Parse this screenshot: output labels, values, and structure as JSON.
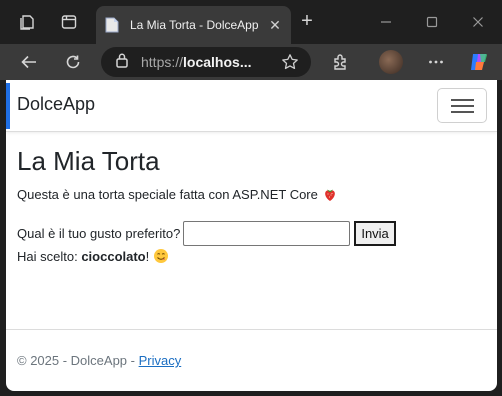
{
  "browser": {
    "tab": {
      "title": "La Mia Torta - DolceApp",
      "close_glyph": "✕"
    },
    "new_tab_glyph": "+",
    "address": {
      "scheme": "https://",
      "host": "localhos..."
    },
    "icons": [
      "workspaces-icon",
      "tab-actions-icon",
      "minimize-icon",
      "maximize-icon",
      "close-window-icon",
      "back-icon",
      "refresh-icon",
      "lock-icon",
      "favorite-star-icon",
      "extensions-icon",
      "more-icon",
      "copilot-icon"
    ]
  },
  "page": {
    "brand": "DolceApp",
    "heading": "La Mia Torta",
    "intro": "Questa è una torta speciale fatta con ASP.NET Core",
    "intro_emoji": "strawberry-icon",
    "form": {
      "label": "Qual è il tuo gusto preferito?",
      "input_value": "",
      "submit_label": "Invia"
    },
    "result": {
      "prefix": "Hai scelto:",
      "value": "cioccolato",
      "suffix": "!",
      "emoji": "yum-face-icon"
    },
    "footer": {
      "text": "© 2025 - DolceApp - ",
      "link": "Privacy"
    }
  },
  "colors": {
    "accent": "#1f6fe5",
    "link": "#1b6ec2",
    "browser_dark": "#1f1f1f",
    "browser_toolbar": "#3a3a3a"
  }
}
